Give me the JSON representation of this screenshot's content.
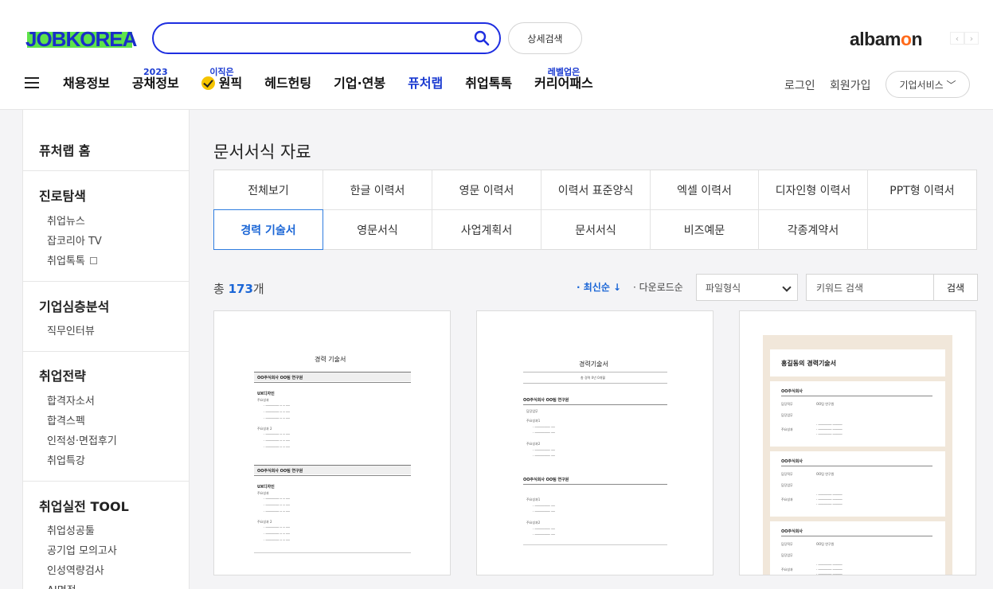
{
  "header": {
    "logo": "JOBKOREA",
    "detail_search": "상세검색",
    "albamon": {
      "pre": "albam",
      "o": "o",
      "post": "n"
    },
    "nav": [
      {
        "label": "채용정보",
        "badge": ""
      },
      {
        "label": "공채정보",
        "badge": "2023"
      },
      {
        "label": "원픽",
        "badge": "이직은"
      },
      {
        "label": "헤드헌팅",
        "badge": ""
      },
      {
        "label": "기업·연봉",
        "badge": ""
      },
      {
        "label": "퓨처랩",
        "badge": ""
      },
      {
        "label": "취업톡톡",
        "badge": ""
      },
      {
        "label": "커리어패스",
        "badge": "레벨업은"
      }
    ],
    "login": "로그인",
    "signup": "회원가입",
    "corp_service": "기업서비스 ﹀"
  },
  "sidebar": {
    "home": "퓨처랩 홈",
    "sections": [
      {
        "title": "진로탐색",
        "links": [
          "취업뉴스",
          "잡코리아 TV",
          "취업톡톡"
        ]
      },
      {
        "title": "기업심층분석",
        "links": [
          "직무인터뷰"
        ]
      },
      {
        "title": "취업전략",
        "links": [
          "합격자소서",
          "합격스펙",
          "인적성·면접후기",
          "취업특강"
        ]
      },
      {
        "title": "취업실전 TOOL",
        "links": [
          "취업성공툴",
          "공기업 모의고사",
          "인성역량검사",
          "AI면접"
        ]
      }
    ]
  },
  "main": {
    "title": "문서서식 자료",
    "categories_row1": [
      "전체보기",
      "한글 이력서",
      "영문 이력서",
      "이력서 표준양식",
      "엑셀 이력서",
      "디자인형 이력서",
      "PPT형 이력서"
    ],
    "categories_row2": [
      "경력 기술서",
      "영문서식",
      "사업계획서",
      "문서서식",
      "비즈예문",
      "각종계약서",
      ""
    ],
    "total_prefix": "총 ",
    "total_count": "173",
    "total_suffix": "개",
    "sort_latest": "· 최신순 ↓",
    "sort_download": "· 다운로드순",
    "file_type": "파일형식",
    "keyword_placeholder": "키워드 검색",
    "search_button": "검색"
  },
  "cards": [
    {
      "title": "경력 기술서",
      "company": "OO주식회사 OO팀 연구원",
      "dept": "UX디자인",
      "task": "주요성과",
      "task2": "주요성과 2"
    },
    {
      "title": "경력기술서",
      "subtitle": "총 경력 0년 0개월",
      "company": "OO주식회사 OO팀 연구원",
      "dept": "담당업무",
      "task": "주요성과1",
      "task2": "주요성과2"
    },
    {
      "title": "홍길동의 경력기술서",
      "company": "OO주식회사",
      "role": "OO팀 연구원",
      "label1": "담당직무",
      "label2": "담당업무",
      "label3": "주요성과"
    }
  ],
  "colors": {
    "brand_blue": "#1a2ec8",
    "brand_green": "#5ee34a",
    "accent": "#1b66d6",
    "albamon_orange": "#ff6a1a"
  }
}
